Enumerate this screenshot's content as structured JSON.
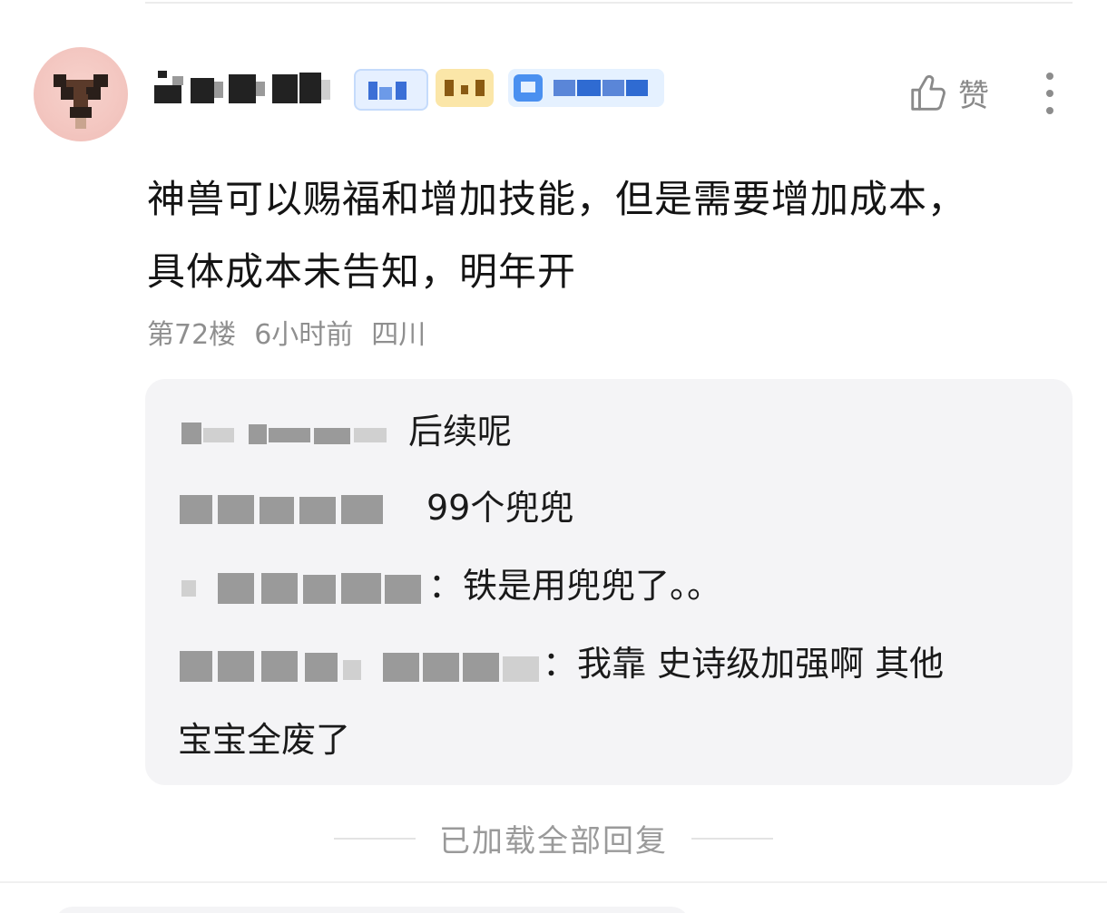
{
  "comment": {
    "text_line1": "神兽可以赐福和增加技能，但是需要增加成本，",
    "text_line2": "具体成本未告知，明年开",
    "floor": "第72楼",
    "time": "6小时前",
    "location": "四川",
    "like_label": "赞"
  },
  "replies": [
    {
      "text": "后续呢"
    },
    {
      "text": "99个兜兜"
    },
    {
      "text": "：铁是用兜兜了。。"
    },
    {
      "text_line1": "：我靠 史诗级加强啊 其他",
      "text_line2": "宝宝全废了"
    }
  ],
  "footer": {
    "loaded_label": "已加载全部回复"
  },
  "icons": {
    "like": "thumbs-up-icon",
    "more": "vertical-dots-icon"
  }
}
